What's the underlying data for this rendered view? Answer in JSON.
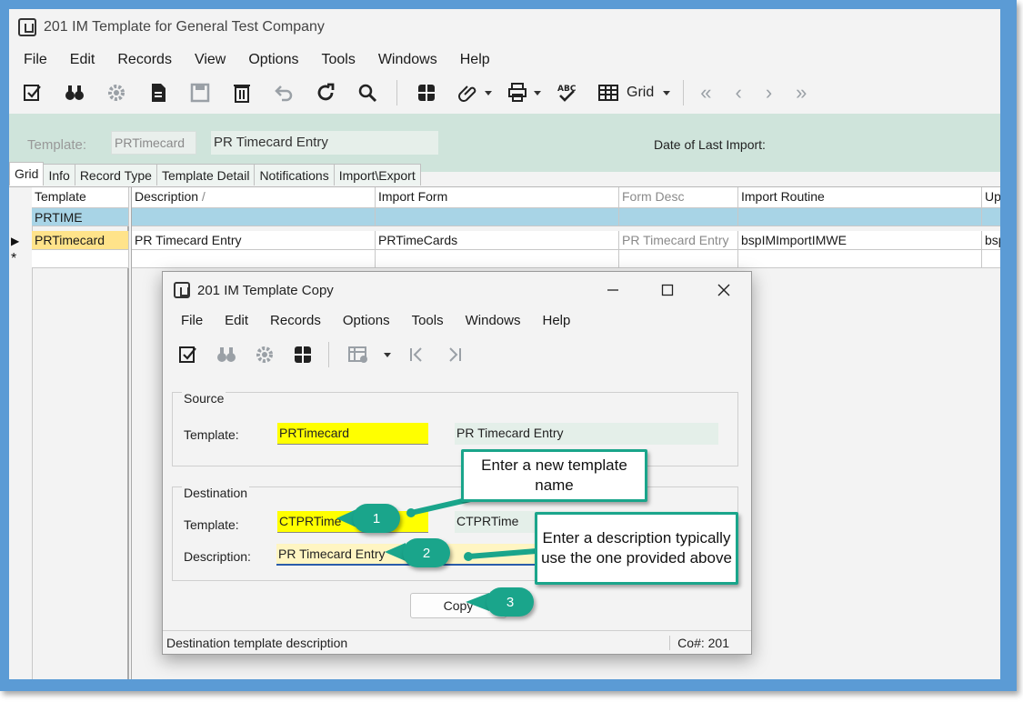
{
  "window": {
    "title": "201 IM Template for General Test Company"
  },
  "menu": [
    "File",
    "Edit",
    "Records",
    "View",
    "Options",
    "Tools",
    "Windows",
    "Help"
  ],
  "toolbar": {
    "grid_label": "Grid"
  },
  "header": {
    "template_label": "Template:",
    "template_code": "PRTimecard",
    "template_desc": "PR Timecard Entry",
    "date_label": "Date of Last Import:"
  },
  "tabs": [
    "Grid",
    "Info",
    "Record Type",
    "Template Detail",
    "Notifications",
    "Import\\Export"
  ],
  "grid": {
    "left_header": "Template",
    "left_filter": "PRTIME",
    "left_row": "PRTimecard",
    "columns": [
      "Description",
      "Import Form",
      "Form Desc",
      "Import Routine",
      "Up"
    ],
    "sort_mark": "/",
    "row": [
      "PR Timecard Entry",
      "PRTimeCards",
      "PR Timecard Entry",
      "bspIMImportIMWE",
      "bsp"
    ],
    "new_row_marker": "*"
  },
  "dialog": {
    "title": "201 IM Template Copy",
    "menu": [
      "File",
      "Edit",
      "Records",
      "Options",
      "Tools",
      "Windows",
      "Help"
    ],
    "source": {
      "group_label": "Source",
      "template_label": "Template:",
      "template_value": "PRTimecard",
      "template_desc": "PR Timecard Entry"
    },
    "destination": {
      "group_label": "Destination",
      "template_label": "Template:",
      "template_value": "CTPRTime",
      "template_desc": "CTPRTime",
      "description_label": "Description:",
      "description_value": "PR Timecard Entry"
    },
    "copy_label": "Copy",
    "status_text": "Destination template description",
    "company": "Co#: 201"
  },
  "callouts": {
    "c1": "Enter a new template name",
    "c2": "Enter a description typically use the one provided above",
    "b1": "1",
    "b2": "2",
    "b3": "3"
  },
  "colors": {
    "frame": "#5b9bd5",
    "header_panel": "#cfe4db",
    "callout": "#1aa58b",
    "highlight": "#ffff00"
  }
}
